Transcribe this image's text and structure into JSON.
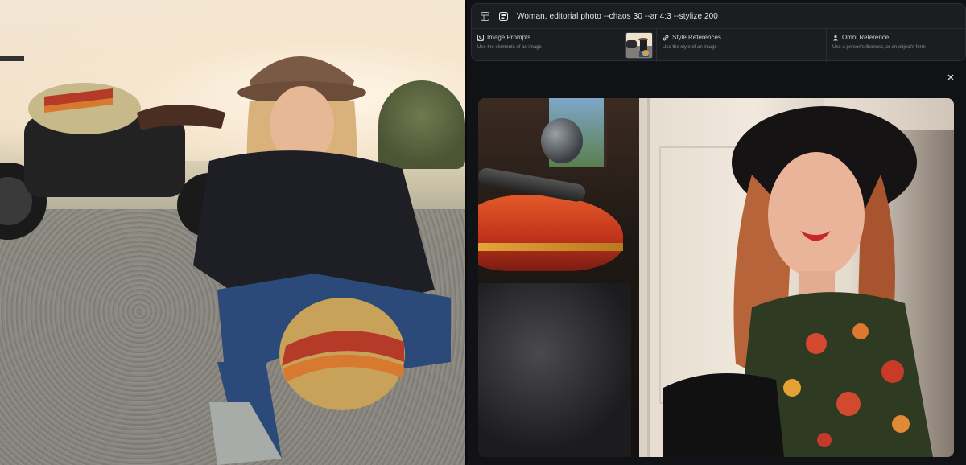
{
  "prompt_bar": {
    "prompt_text": "Woman, editorial photo --chaos 30 --ar 4:3 --stylize 200"
  },
  "references": [
    {
      "title": "Image Prompts",
      "subtitle": "Use the elements of an image",
      "icon": "image-icon"
    },
    {
      "title": "Style References",
      "subtitle": "Use the style of an image",
      "icon": "link-icon"
    },
    {
      "title": "Omni Reference",
      "subtitle": "Use a person's likeness, or an object's form",
      "icon": "person-icon"
    }
  ],
  "colors": {
    "panel_bg": "#111215",
    "card_bg": "#1b1d21",
    "text_primary": "#e6e7ea",
    "text_secondary": "#8c9098"
  }
}
